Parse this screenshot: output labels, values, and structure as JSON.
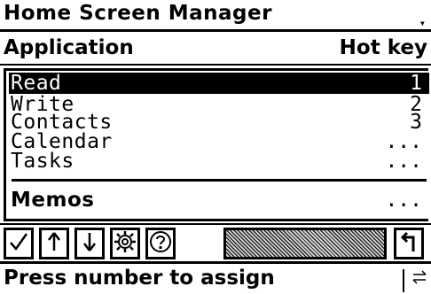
{
  "window": {
    "title": "Home Screen Manager",
    "menu_arrow": "▾"
  },
  "columns": {
    "application": "Application",
    "hotkey": "Hot key"
  },
  "list": {
    "items": [
      {
        "name": "Read",
        "key": "1",
        "selected": true
      },
      {
        "name": "Write",
        "key": "2",
        "selected": false
      },
      {
        "name": "Contacts",
        "key": "3",
        "selected": false
      },
      {
        "name": "Calendar",
        "key": "...",
        "selected": false
      },
      {
        "name": "Tasks",
        "key": "...",
        "selected": false
      },
      {
        "name": "Memos",
        "key": "...",
        "selected": false
      }
    ]
  },
  "toolbar": {
    "buttons": [
      "check-icon",
      "up-arrow-icon",
      "down-arrow-icon",
      "settings-gear-icon",
      "help-icon",
      "back-icon"
    ]
  },
  "status": {
    "text": "Press number to assign"
  }
}
